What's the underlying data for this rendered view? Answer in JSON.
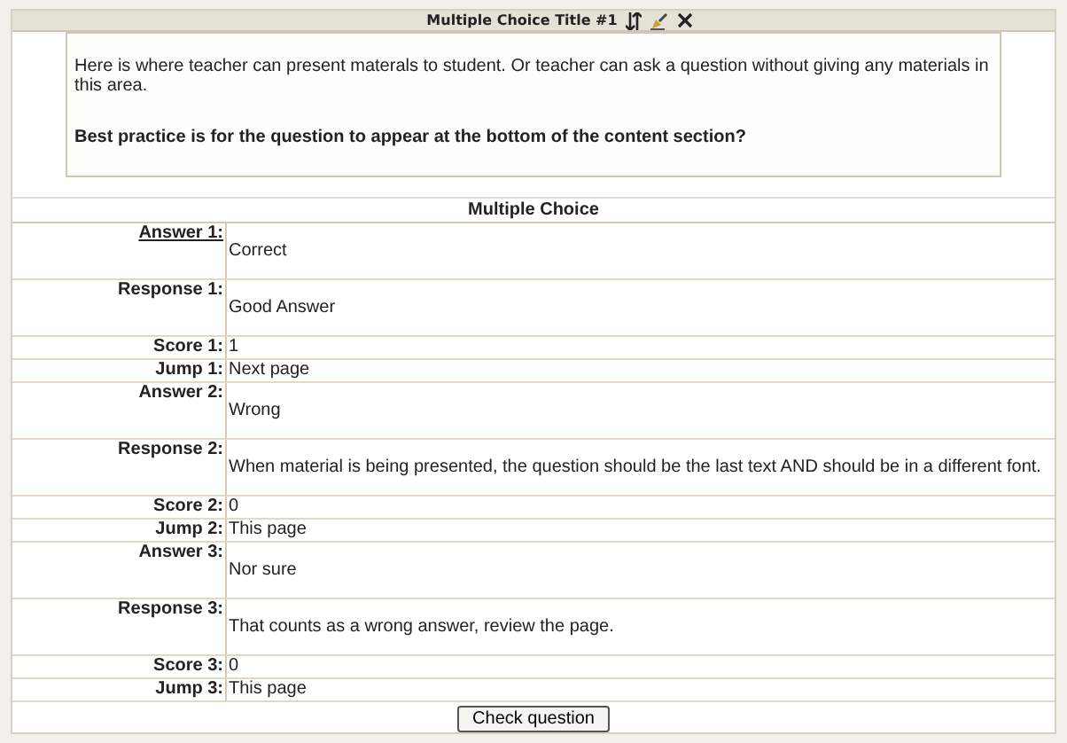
{
  "panel": {
    "title": "Multiple Choice Title #1"
  },
  "content": {
    "paragraphs": [
      {
        "text": "Here is where teacher can present materals to student.  Or teacher can ask a question without giving any materials in this area.",
        "bold": false
      },
      {
        "text": "Best practice is for the question to appear at the bottom of the content section?",
        "bold": true
      }
    ]
  },
  "table": {
    "heading": "Multiple Choice",
    "rows": [
      {
        "label": "Answer 1:",
        "value": "Correct",
        "kind": "text",
        "underlined": true
      },
      {
        "label": "Response 1:",
        "value": "Good Answer",
        "kind": "text",
        "underlined": false
      },
      {
        "label": "Score 1:",
        "value": "1",
        "kind": "line",
        "underlined": false
      },
      {
        "label": "Jump 1:",
        "value": "Next page",
        "kind": "line",
        "underlined": false
      },
      {
        "label": "Answer 2:",
        "value": "Wrong",
        "kind": "text",
        "underlined": false
      },
      {
        "label": "Response 2:",
        "value": "When material is being presented, the question should be the last text AND should be in a different font.",
        "kind": "text",
        "underlined": false
      },
      {
        "label": "Score 2:",
        "value": "0",
        "kind": "line",
        "underlined": false
      },
      {
        "label": "Jump 2:",
        "value": "This page",
        "kind": "line",
        "underlined": false
      },
      {
        "label": "Answer 3:",
        "value": "Nor sure",
        "kind": "text",
        "underlined": false
      },
      {
        "label": "Response 3:",
        "value": "That counts as a wrong answer, review the page.",
        "kind": "text",
        "underlined": false
      },
      {
        "label": "Score 3:",
        "value": "0",
        "kind": "line",
        "underlined": false
      },
      {
        "label": "Jump 3:",
        "value": "This page",
        "kind": "line",
        "underlined": false
      }
    ],
    "button": "Check question"
  }
}
